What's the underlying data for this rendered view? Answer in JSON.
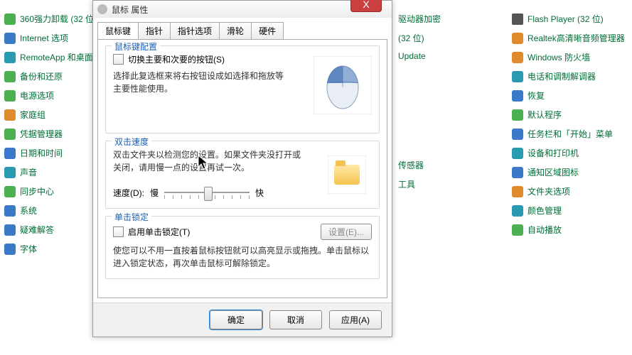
{
  "left_items": [
    {
      "label": "360强力卸载 (32 位"
    },
    {
      "label": "Internet 选项"
    },
    {
      "label": "RemoteApp 和桌面"
    },
    {
      "label": "备份和还原"
    },
    {
      "label": "电源选项"
    },
    {
      "label": "家庭组"
    },
    {
      "label": "凭据管理器"
    },
    {
      "label": "日期和时间"
    },
    {
      "label": "声音"
    },
    {
      "label": "同步中心"
    },
    {
      "label": "系统"
    },
    {
      "label": "疑难解答"
    },
    {
      "label": "字体"
    }
  ],
  "mid_items": [
    {
      "label": "驱动器加密"
    },
    {
      "label": "(32 位)"
    },
    {
      "label": "Update"
    },
    {
      "label": "传感器"
    },
    {
      "label": "工具"
    }
  ],
  "right_items": [
    {
      "label": "Flash Player (32 位)"
    },
    {
      "label": "Realtek高清晰音频管理器"
    },
    {
      "label": "Windows 防火墙"
    },
    {
      "label": "电话和调制解调器"
    },
    {
      "label": "恢复"
    },
    {
      "label": "默认程序"
    },
    {
      "label": "任务栏和「开始」菜单"
    },
    {
      "label": "设备和打印机"
    },
    {
      "label": "通知区域图标"
    },
    {
      "label": "文件夹选项"
    },
    {
      "label": "颜色管理"
    },
    {
      "label": "自动播放"
    }
  ],
  "dialog": {
    "title": "鼠标 属性",
    "close": "X",
    "tabs": [
      "鼠标键",
      "指针",
      "指针选项",
      "滑轮",
      "硬件"
    ],
    "active_tab": 0,
    "btncfg": {
      "legend": "鼠标键配置",
      "checkbox": "切换主要和次要的按钮(S)",
      "desc": "选择此复选框来将右按钮设成如选择和拖放等主要性能使用。"
    },
    "dbl": {
      "legend": "双击速度",
      "desc": "双击文件夹以检测您的设置。如果文件夹没打开或关闭，请用慢一点的设置再试一次。",
      "speed_label": "速度(D):",
      "slow": "慢",
      "fast": "快"
    },
    "lock": {
      "legend": "单击锁定",
      "checkbox": "启用单击锁定(T)",
      "settings_btn": "设置(E)...",
      "desc": "使您可以不用一直按着鼠标按钮就可以高亮显示或拖拽。单击鼠标以进入锁定状态，再次单击鼠标可解除锁定。"
    },
    "buttons": {
      "ok": "确定",
      "cancel": "取消",
      "apply": "应用(A)"
    }
  }
}
